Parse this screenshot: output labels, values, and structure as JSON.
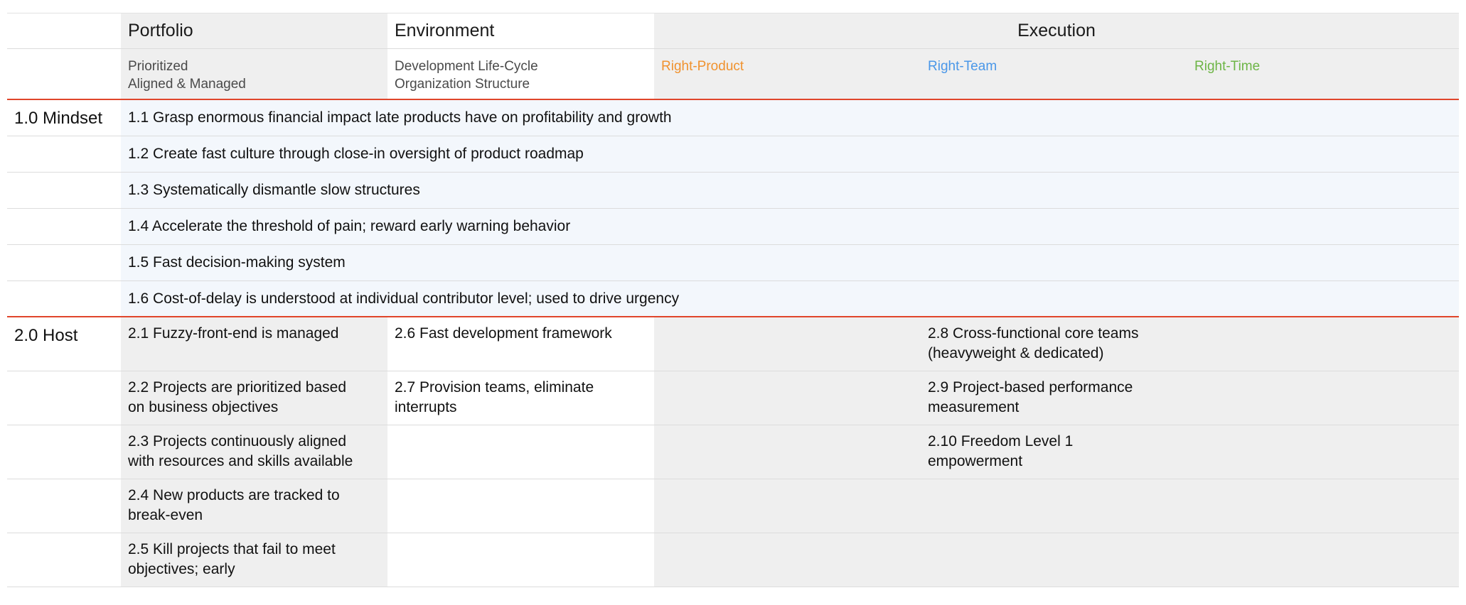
{
  "header": {
    "portfolio": "Portfolio",
    "environment": "Environment",
    "execution": "Execution",
    "portfolio_sub": [
      "Prioritized",
      "Aligned & Managed"
    ],
    "environment_sub": [
      "Development Life-Cycle",
      "Organization Structure"
    ],
    "right_product": "Right-Product",
    "right_team": "Right-Team",
    "right_time": "Right-Time"
  },
  "colors": {
    "right_product": "#f0922e",
    "right_team": "#4a97e8",
    "right_time": "#6db546",
    "divider": "#e0452b"
  },
  "mindset": {
    "label": "1.0 Mindset",
    "items": [
      "1.1 Grasp enormous financial impact late products have on profitability and growth",
      "1.2 Create fast culture through close-in oversight of product roadmap",
      "1.3 Systematically dismantle slow structures",
      "1.4 Accelerate the threshold of pain; reward early warning behavior",
      "1.5 Fast decision-making system",
      "1.6 Cost-of-delay is understood at individual contributor level; used to drive urgency"
    ]
  },
  "host": {
    "label": "2.0 Host",
    "rows": [
      {
        "portfolio": "2.1 Fuzzy-front-end is managed",
        "environment": "2.6 Fast development framework",
        "team": "2.8 Cross-functional core teams\n(heavyweight & dedicated)"
      },
      {
        "portfolio": "2.2 Projects are prioritized based\non business objectives",
        "environment": "2.7 Provision teams, eliminate\ninterrupts",
        "team": "2.9 Project-based performance\nmeasurement"
      },
      {
        "portfolio": "2.3 Projects continuously aligned\nwith resources and skills available",
        "environment": "",
        "team": "2.10 Freedom Level 1\nempowerment"
      },
      {
        "portfolio": "2.4 New products are tracked to\nbreak-even",
        "environment": "",
        "team": ""
      },
      {
        "portfolio": "2.5 Kill projects that fail to meet\nobjectives; early",
        "environment": "",
        "team": ""
      }
    ]
  }
}
